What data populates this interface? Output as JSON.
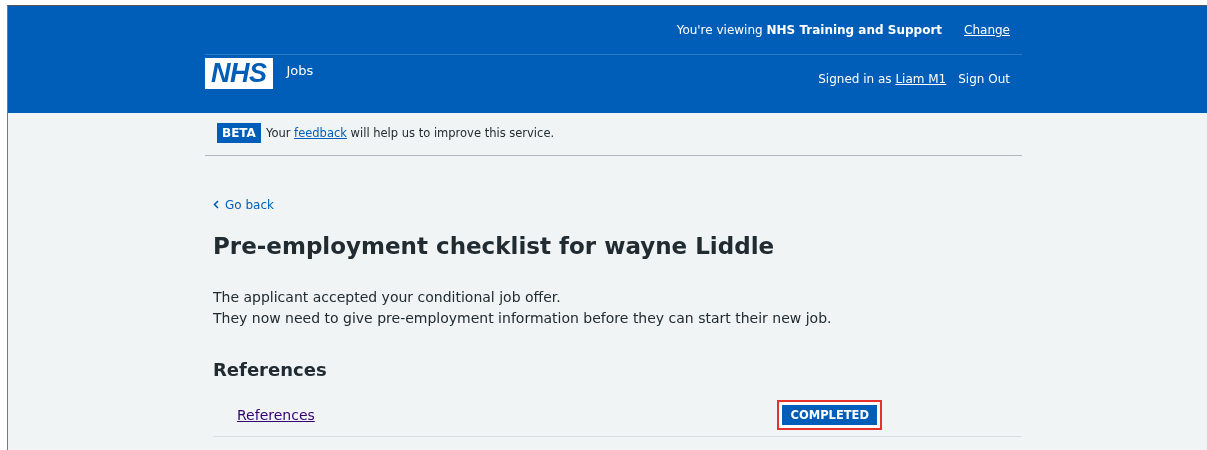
{
  "header": {
    "logo": "NHS",
    "service": "Jobs",
    "viewing_prefix": "You're viewing ",
    "organisation": "NHS Training and Support",
    "change_link": "Change",
    "signed_in_prefix": "Signed in as ",
    "user_link": "Liam M1",
    "sign_out": "Sign Out"
  },
  "beta_banner": {
    "tag": "BETA",
    "before": "Your ",
    "link": "feedback",
    "after": " will help us to improve this service."
  },
  "back_link": "Go back",
  "title": "Pre-employment checklist for wayne Liddle",
  "intro": [
    "The applicant accepted your conditional job offer.",
    "They now need to give pre-employment information before they can start their new job."
  ],
  "sections": [
    {
      "heading": "References",
      "tasks": [
        {
          "label": "References",
          "status": "COMPLETED",
          "highlighted": true
        }
      ]
    }
  ]
}
